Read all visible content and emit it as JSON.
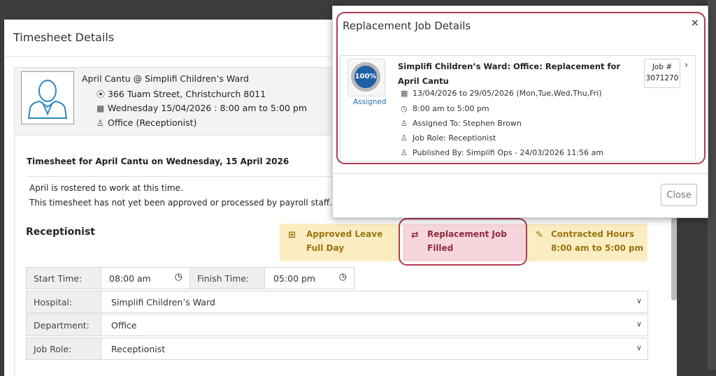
{
  "main": {
    "title": "Timesheet Details",
    "profile": {
      "name_line": "April Cantu @ Simplifi Children’s Ward",
      "address": "366 Tuam Street, Christchurch 8011",
      "datetime": "Wednesday 15/04/2026 : 8:00 am to 5:00 pm",
      "role": "Office (Receptionist)"
    },
    "timesheet_heading": "Timesheet for April Cantu on Wednesday, 15 April 2026",
    "notes": [
      "April is rostered to work at this time.",
      "This timesheet has not yet been approved or processed by payroll staff."
    ],
    "role_heading": "Receptionist",
    "statuses": {
      "leave": {
        "line1": "Approved Leave",
        "line2": "Full Day",
        "icon": "medical-bag-icon"
      },
      "replacement": {
        "line1": "Replacement Job",
        "line2": "Filled",
        "icon": "calendar-swap-icon"
      },
      "hours": {
        "line1": "Contracted Hours",
        "line2": "8:00 am to 5:00 pm",
        "icon": "contract-pen-icon"
      }
    },
    "form": {
      "start_label": "Start Time:",
      "start_value": "08:00 am",
      "finish_label": "Finish Time:",
      "finish_value": "05:00 pm",
      "hospital_label": "Hospital:",
      "hospital_value": "Simplifi Children’s Ward",
      "department_label": "Department:",
      "department_value": "Office",
      "jobrole_label": "Job Role:",
      "jobrole_value": "Receptionist"
    }
  },
  "popup": {
    "title": "Replacement Job Details",
    "close_x": "×",
    "fill_percent_label": "100%",
    "fill_percent": 100,
    "assigned_label": "Assigned",
    "job_title": "Simplifi Children’s Ward:  Office: Replacement for April Cantu",
    "dates": "13/04/2026 to 29/05/2026  (Mon,Tue,Wed,Thu,Fri)",
    "hours": "8:00 am to 5:00 pm",
    "assigned_to": "Assigned To: Stephen Brown",
    "job_role": "Job Role: Receptionist",
    "published_by": "Published By: Simplifi Ops - 24/03/2026 11:56 am",
    "job_number_label": "Job #",
    "job_number": "3071270",
    "close_button": "Close"
  },
  "colors": {
    "highlight": "#b23a52",
    "amber_bg": "#fbedc2",
    "pink_bg": "#f6d6dc",
    "accent_blue": "#1f6fb2"
  }
}
